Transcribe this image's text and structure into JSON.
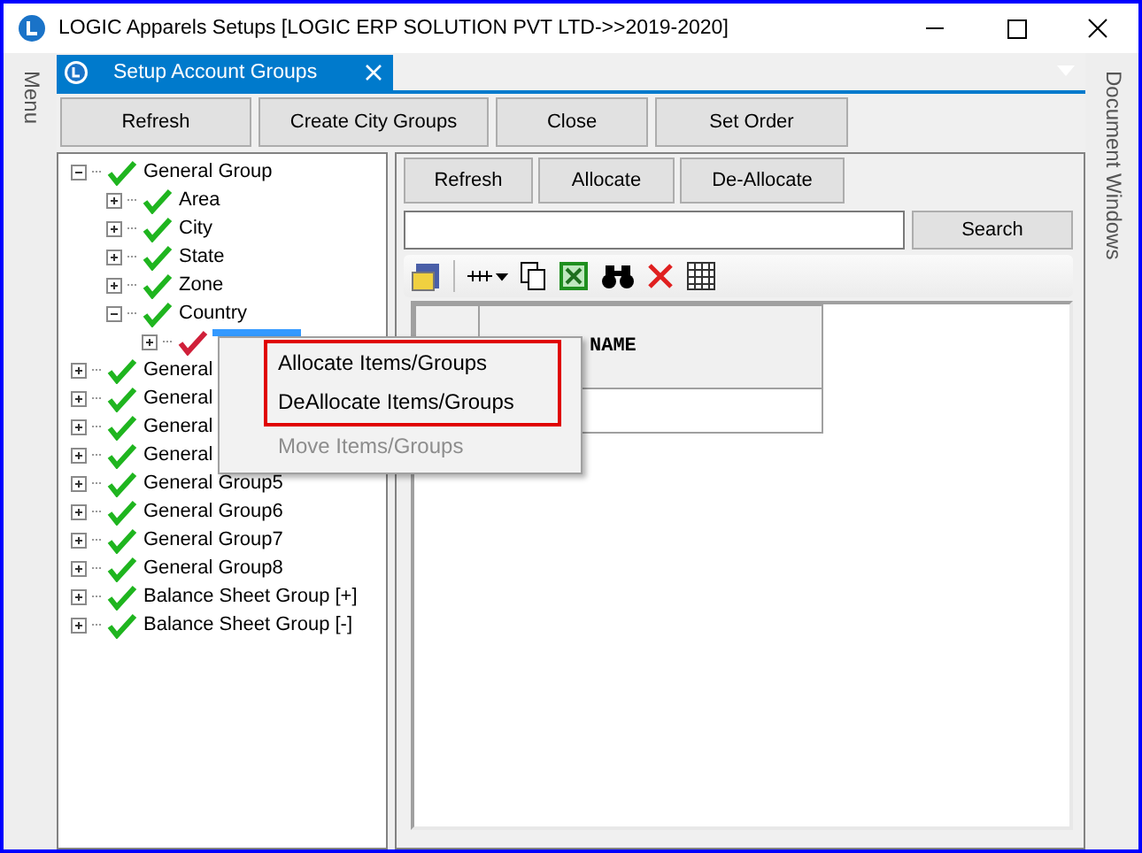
{
  "window": {
    "title": "LOGIC Apparels Setups  [LOGIC ERP SOLUTION PVT LTD->>2019-2020]"
  },
  "side_panels": {
    "left": "Menu",
    "right": "Document Windows"
  },
  "tabs": [
    {
      "label": "Setup Account Groups",
      "selected": true
    }
  ],
  "toolbar": [
    "Refresh",
    "Create City Groups",
    "Close",
    "Set Order"
  ],
  "tree": [
    {
      "label": "General Group",
      "expanded": true,
      "selected": false,
      "color": "#1fb51f",
      "children": [
        {
          "label": "Area",
          "expanded": false,
          "selected": false,
          "color": "#1fb51f"
        },
        {
          "label": "City",
          "expanded": false,
          "selected": false,
          "color": "#1fb51f"
        },
        {
          "label": "State",
          "expanded": false,
          "selected": false,
          "color": "#1fb51f"
        },
        {
          "label": "Zone",
          "expanded": false,
          "selected": false,
          "color": "#1fb51f"
        },
        {
          "label": "Country",
          "expanded": true,
          "selected": false,
          "color": "#1fb51f",
          "children": [
            {
              "expanded": false,
              "selected": true,
              "color": "#d0203a"
            }
          ]
        }
      ]
    },
    {
      "label": "General",
      "expanded": false,
      "selected": false,
      "color": "#1fb51f"
    },
    {
      "label": "General",
      "expanded": false,
      "selected": false,
      "color": "#1fb51f"
    },
    {
      "label": "General",
      "expanded": false,
      "selected": false,
      "color": "#1fb51f"
    },
    {
      "label": "General",
      "expanded": false,
      "selected": false,
      "color": "#1fb51f"
    },
    {
      "label": "General Group5",
      "expanded": false,
      "selected": false,
      "color": "#1fb51f"
    },
    {
      "label": "General Group6",
      "expanded": false,
      "selected": false,
      "color": "#1fb51f"
    },
    {
      "label": "General Group7",
      "expanded": false,
      "selected": false,
      "color": "#1fb51f"
    },
    {
      "label": "General Group8",
      "expanded": false,
      "selected": false,
      "color": "#1fb51f"
    },
    {
      "label": "Balance Sheet Group [+]",
      "expanded": false,
      "selected": false,
      "color": "#1fb51f"
    },
    {
      "label": "Balance Sheet Group [-]",
      "expanded": false,
      "selected": false,
      "color": "#1fb51f"
    }
  ],
  "right_panel": {
    "buttons": [
      "Refresh",
      "Allocate",
      "De-Allocate"
    ],
    "search_button": "Search"
  },
  "grid": {
    "columns": [
      "NAME"
    ]
  },
  "context_menu": {
    "items": [
      {
        "label": "Allocate Items/Groups",
        "disabled": false,
        "outlined": true
      },
      {
        "label": "DeAllocate Items/Groups",
        "disabled": false,
        "outlined": true
      },
      {
        "label": "Move Items/Groups",
        "disabled": true,
        "outlined": false
      }
    ]
  }
}
